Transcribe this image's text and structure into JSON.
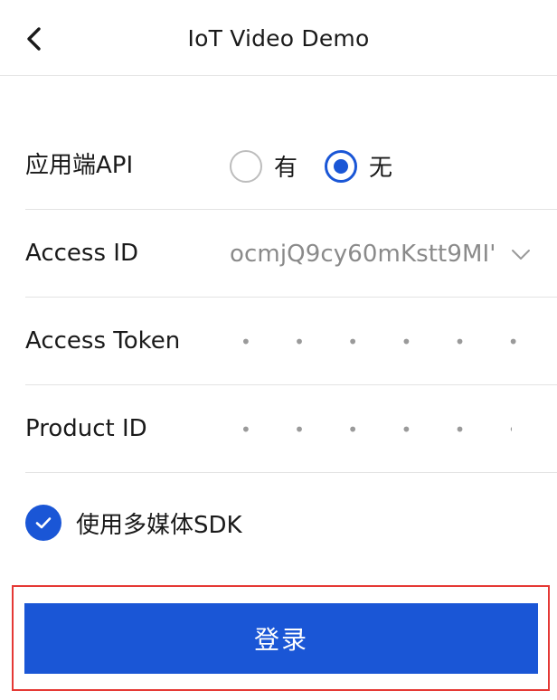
{
  "header": {
    "title": "IoT Video Demo",
    "back_icon": "chevron-left-icon"
  },
  "form": {
    "app_api": {
      "label": "应用端API",
      "options": [
        {
          "label": "有",
          "selected": false
        },
        {
          "label": "无",
          "selected": true
        }
      ]
    },
    "access_id": {
      "label": "Access ID",
      "value": "'ocmjQ9cy60mKstt9MI",
      "dropdown_icon": "chevron-down-icon"
    },
    "access_token": {
      "label": "Access Token",
      "masked_value": "• • • • • • • • • • •"
    },
    "product_id": {
      "label": "Product ID",
      "masked_value": "• • • • • • • • • • •"
    },
    "multimedia_sdk": {
      "label": "使用多媒体SDK",
      "checked": true
    }
  },
  "login": {
    "label": "登录"
  },
  "colors": {
    "accent": "#1a56d6",
    "highlight_frame": "#e53935",
    "divider": "#e3e3e3",
    "muted_text": "#8a8a8a"
  }
}
